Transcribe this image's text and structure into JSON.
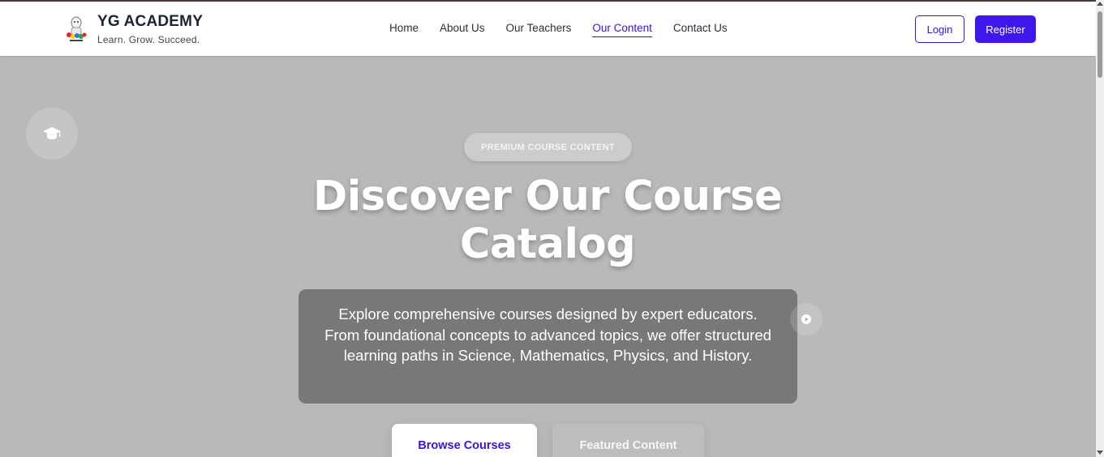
{
  "brand": {
    "name": "YG ACADEMY",
    "tagline": "Learn. Grow. Succeed.",
    "logo_icon": "academy-mascot-logo"
  },
  "nav": {
    "items": [
      {
        "label": "Home",
        "active": false
      },
      {
        "label": "About Us",
        "active": false
      },
      {
        "label": "Our Teachers",
        "active": false
      },
      {
        "label": "Our Content",
        "active": true
      },
      {
        "label": "Contact Us",
        "active": false
      }
    ]
  },
  "auth": {
    "login_label": "Login",
    "register_label": "Register"
  },
  "hero": {
    "badge": "PREMIUM COURSE CONTENT",
    "title_line1": "Discover Our Course",
    "title_line2": "Catalog",
    "description": "Explore comprehensive courses designed by expert educators. From foundational concepts to advanced topics, we offer structured learning paths in Science, Mathematics, Physics, and History.",
    "primary_cta": "Browse Courses",
    "secondary_cta": "Featured Content",
    "floating_icons": [
      "graduation-cap-icon",
      "play-icon"
    ]
  },
  "colors": {
    "accent": "#3f17ec",
    "link_active": "#3b14d6",
    "hero_bg": "#b9b9b9",
    "header_bg": "#ffffff"
  }
}
